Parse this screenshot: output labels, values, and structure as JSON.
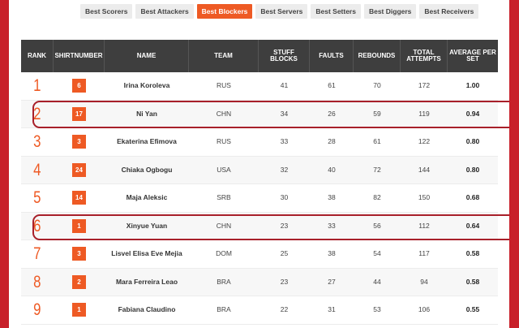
{
  "tabs": [
    {
      "label": "Best Scorers",
      "active": false
    },
    {
      "label": "Best Attackers",
      "active": false
    },
    {
      "label": "Best Blockers",
      "active": true
    },
    {
      "label": "Best Servers",
      "active": false
    },
    {
      "label": "Best Setters",
      "active": false
    },
    {
      "label": "Best Diggers",
      "active": false
    },
    {
      "label": "Best Receivers",
      "active": false
    }
  ],
  "columns": [
    "RANK",
    "SHIRTNUMBER",
    "NAME",
    "TEAM",
    "STUFF BLOCKS",
    "FAULTS",
    "REBOUNDS",
    "TOTAL ATTEMPTS",
    "AVERAGE PER SET"
  ],
  "rows": [
    {
      "rank": "1",
      "shirt": "6",
      "name": "Irina Koroleva",
      "team": "RUS",
      "stuff": "41",
      "faults": "61",
      "rebounds": "70",
      "total": "172",
      "avg": "1.00"
    },
    {
      "rank": "2",
      "shirt": "17",
      "name": "Ni Yan",
      "team": "CHN",
      "stuff": "34",
      "faults": "26",
      "rebounds": "59",
      "total": "119",
      "avg": "0.94"
    },
    {
      "rank": "3",
      "shirt": "3",
      "name": "Ekaterina Efimova",
      "team": "RUS",
      "stuff": "33",
      "faults": "28",
      "rebounds": "61",
      "total": "122",
      "avg": "0.80"
    },
    {
      "rank": "4",
      "shirt": "24",
      "name": "Chiaka Ogbogu",
      "team": "USA",
      "stuff": "32",
      "faults": "40",
      "rebounds": "72",
      "total": "144",
      "avg": "0.80"
    },
    {
      "rank": "5",
      "shirt": "14",
      "name": "Maja Aleksic",
      "team": "SRB",
      "stuff": "30",
      "faults": "38",
      "rebounds": "82",
      "total": "150",
      "avg": "0.68"
    },
    {
      "rank": "6",
      "shirt": "1",
      "name": "Xinyue Yuan",
      "team": "CHN",
      "stuff": "23",
      "faults": "33",
      "rebounds": "56",
      "total": "112",
      "avg": "0.64"
    },
    {
      "rank": "7",
      "shirt": "3",
      "name": "Lisvel Elisa Eve Mejia",
      "team": "DOM",
      "stuff": "25",
      "faults": "38",
      "rebounds": "54",
      "total": "117",
      "avg": "0.58"
    },
    {
      "rank": "8",
      "shirt": "2",
      "name": "Mara Ferreira Leao",
      "team": "BRA",
      "stuff": "23",
      "faults": "27",
      "rebounds": "44",
      "total": "94",
      "avg": "0.58"
    },
    {
      "rank": "9",
      "shirt": "1",
      "name": "Fabiana Claudino",
      "team": "BRA",
      "stuff": "22",
      "faults": "31",
      "rebounds": "53",
      "total": "106",
      "avg": "0.55"
    }
  ],
  "highlighted_ranks": [
    "2",
    "6"
  ],
  "colors": {
    "accent": "#ee5a24",
    "header_bg": "#3e3e3e",
    "frame": "#c8202a",
    "highlight_ring": "#a8202a"
  }
}
